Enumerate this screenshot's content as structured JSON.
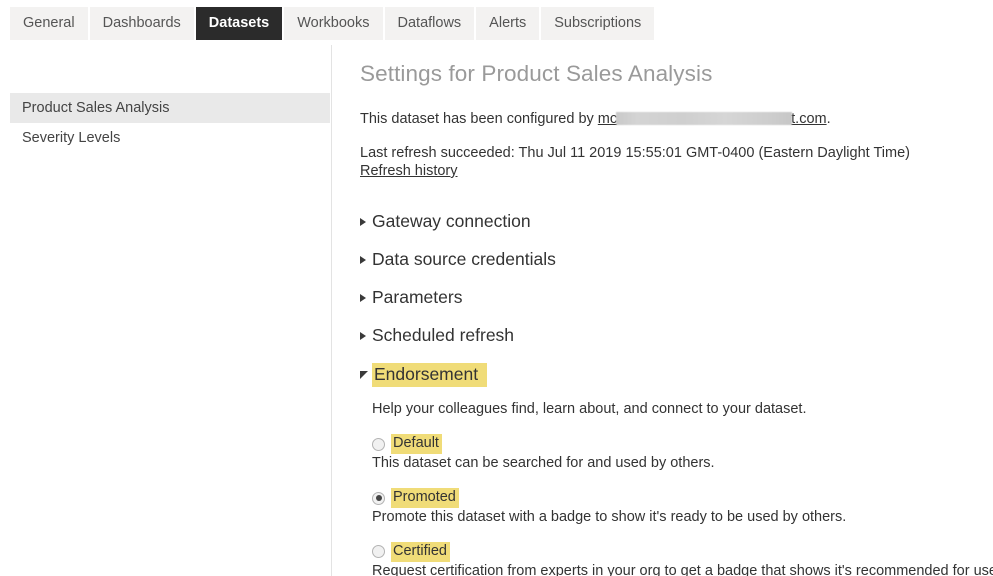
{
  "tabs": [
    {
      "label": "General",
      "active": false
    },
    {
      "label": "Dashboards",
      "active": false
    },
    {
      "label": "Datasets",
      "active": true
    },
    {
      "label": "Workbooks",
      "active": false
    },
    {
      "label": "Dataflows",
      "active": false
    },
    {
      "label": "Alerts",
      "active": false
    },
    {
      "label": "Subscriptions",
      "active": false
    }
  ],
  "sidebar": {
    "items": [
      {
        "label": "Product Sales Analysis",
        "selected": true
      },
      {
        "label": "Severity Levels",
        "selected": false
      }
    ]
  },
  "main": {
    "page_title": "Settings for Product Sales Analysis",
    "configured_prefix": "This dataset has been configured by ",
    "configured_link_start": "mc",
    "configured_link_end": "t.com",
    "configured_suffix": ".",
    "last_refresh": "Last refresh succeeded: Thu Jul 11 2019 15:55:01 GMT-0400 (Eastern Daylight Time)",
    "refresh_history_link": "Refresh history",
    "sections": [
      {
        "title": "Gateway connection",
        "expanded": false
      },
      {
        "title": "Data source credentials",
        "expanded": false
      },
      {
        "title": "Parameters",
        "expanded": false
      },
      {
        "title": "Scheduled refresh",
        "expanded": false
      },
      {
        "title": "Endorsement",
        "expanded": true
      }
    ],
    "endorsement": {
      "title": "Endorsement",
      "description": "Help your colleagues find, learn about, and connect to your dataset.",
      "options": [
        {
          "label": "Default",
          "checked": false,
          "description": "This dataset can be searched for and used by others."
        },
        {
          "label": "Promoted",
          "checked": true,
          "description": "Promote this dataset with a badge to show it's ready to be used by others."
        },
        {
          "label": "Certified",
          "checked": false,
          "description": "Request certification from experts in your org to get a badge that shows it's recommended for use by others"
        }
      ]
    }
  },
  "colors": {
    "highlight": "#f0dc78",
    "active_tab_bg": "#2b2b2b",
    "tab_bg": "#f3f2f1",
    "sidebar_selected_bg": "#e9e9e9",
    "title_color": "#9a9a9a"
  }
}
